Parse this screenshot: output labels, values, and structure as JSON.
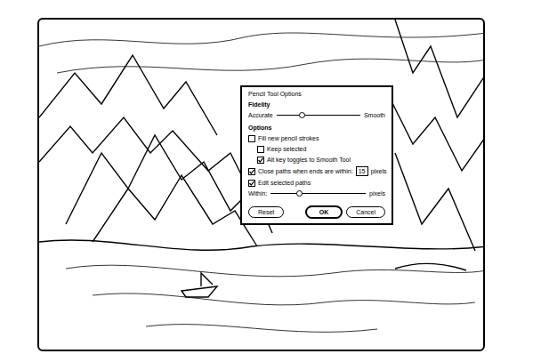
{
  "dialog": {
    "title": "Pencil Tool Options"
  },
  "fidelity": {
    "label": "Fidelity",
    "left": "Accurate",
    "right": "Smooth",
    "level": 0.3
  },
  "options": {
    "label": "Options",
    "items": [
      {
        "kind": "checkbox",
        "label": "Fill new pencil strokes",
        "checked": false,
        "indent": false
      },
      {
        "kind": "checkbox",
        "label": "Keep selected",
        "checked": false,
        "indent": true
      },
      {
        "kind": "checkbox",
        "label": "Alt key toggles to Smooth Tool",
        "checked": true,
        "indent": true
      },
      {
        "kind": "field",
        "label": "Close paths when ends are within:",
        "checked": true,
        "value": "15",
        "unit": "pixels"
      },
      {
        "kind": "checkbox",
        "label": "Edit selected paths",
        "checked": true,
        "indent": false
      },
      {
        "kind": "slider",
        "label": "Within:",
        "level": 0.3,
        "unit": "pixels"
      }
    ]
  },
  "buttons": [
    {
      "label": "Reset",
      "default": false
    },
    {
      "label": "OK",
      "default": true
    },
    {
      "label": "Cancel",
      "default": false
    }
  ]
}
